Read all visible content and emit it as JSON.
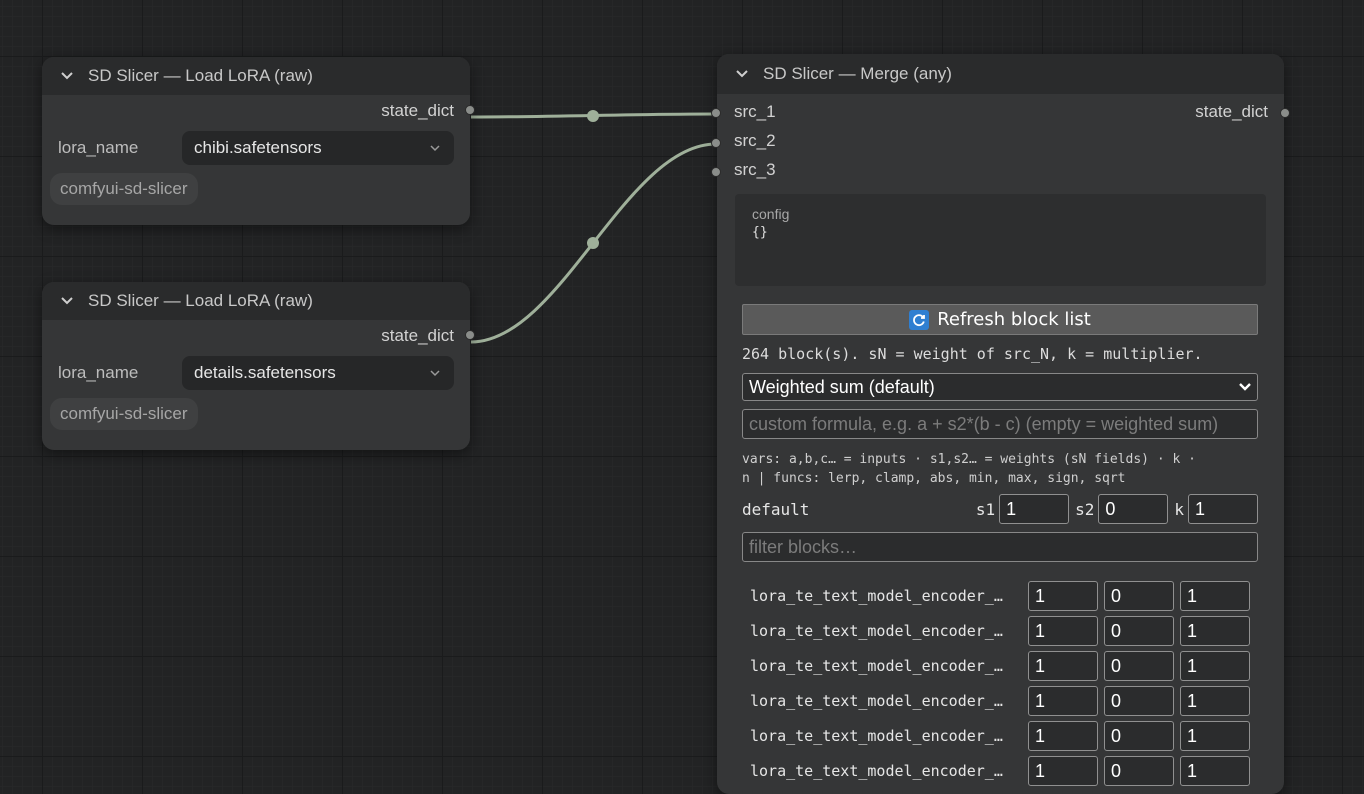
{
  "nodes": {
    "lora1": {
      "title": "SD Slicer — Load LoRA (raw)",
      "output_label": "state_dict",
      "widget_label": "lora_name",
      "widget_value": "chibi.safetensors",
      "badge": "comfyui-sd-slicer"
    },
    "lora2": {
      "title": "SD Slicer — Load LoRA (raw)",
      "output_label": "state_dict",
      "widget_label": "lora_name",
      "widget_value": "details.safetensors",
      "badge": "comfyui-sd-slicer"
    },
    "merge": {
      "title": "SD Slicer — Merge (any)",
      "inputs": [
        "src_1",
        "src_2",
        "src_3"
      ],
      "output_label": "state_dict",
      "config_label": "config",
      "config_value": "{}",
      "refresh_label": "Refresh block list",
      "info_text": "264 block(s). sN = weight of src_N, k = multiplier.",
      "mode_selected": "Weighted sum (default)",
      "formula_placeholder": "custom formula, e.g.  a + s2*(b - c)   (empty = weighted sum)",
      "vars_line1": "vars: a,b,c… = inputs · s1,s2… = weights (sN fields) · k ·",
      "vars_line2": "n | funcs: lerp, clamp, abs, min, max, sign, sqrt",
      "default_label": "default",
      "default_s1_label": "s1",
      "default_s1": "1",
      "default_s2_label": "s2",
      "default_s2": "0",
      "default_k_label": "k",
      "default_k": "1",
      "filter_placeholder": "filter blocks…",
      "blocks": [
        {
          "name": "lora_te_text_model_encoder_…",
          "s1": "1",
          "s2": "0",
          "k": "1"
        },
        {
          "name": "lora_te_text_model_encoder_…",
          "s1": "1",
          "s2": "0",
          "k": "1"
        },
        {
          "name": "lora_te_text_model_encoder_…",
          "s1": "1",
          "s2": "0",
          "k": "1"
        },
        {
          "name": "lora_te_text_model_encoder_…",
          "s1": "1",
          "s2": "0",
          "k": "1"
        },
        {
          "name": "lora_te_text_model_encoder_…",
          "s1": "1",
          "s2": "0",
          "k": "1"
        },
        {
          "name": "lora_te_text_model_encoder_…",
          "s1": "1",
          "s2": "0",
          "k": "1"
        }
      ]
    }
  },
  "icons": {
    "collapse": "chevron-down-icon",
    "combo": "chevron-down-icon",
    "refresh": "refresh-icon"
  },
  "colors": {
    "canvas": "#222324",
    "node_body": "#353637",
    "node_header": "#2a2b2c",
    "link": "#9fb09a",
    "refresh_icon": "#2f7fd1"
  }
}
